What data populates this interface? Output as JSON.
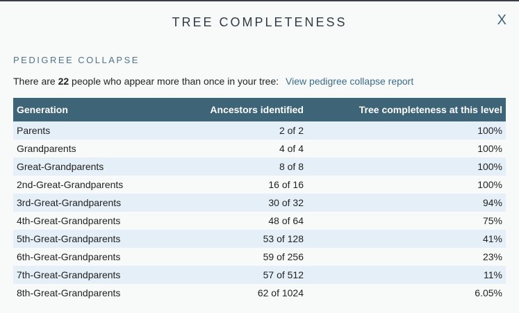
{
  "modal": {
    "title": "TREE COMPLETENESS",
    "close_label": "X"
  },
  "pedigree": {
    "heading": "PEDIGREE COLLAPSE",
    "summary_prefix": "There are ",
    "count": "22",
    "summary_suffix": " people who appear more than once in your tree:",
    "report_link": "View pedigree collapse report"
  },
  "table": {
    "headers": [
      "Generation",
      "Ancestors identified",
      "Tree completeness at this level"
    ],
    "rows": [
      [
        "Parents",
        "2 of 2",
        "100%"
      ],
      [
        "Grandparents",
        "4 of 4",
        "100%"
      ],
      [
        "Great-Grandparents",
        "8 of 8",
        "100%"
      ],
      [
        "2nd-Great-Grandparents",
        "16 of 16",
        "100%"
      ],
      [
        "3rd-Great-Grandparents",
        "30 of 32",
        "94%"
      ],
      [
        "4th-Great-Grandparents",
        "48 of 64",
        "75%"
      ],
      [
        "5th-Great-Grandparents",
        "53 of 128",
        "41%"
      ],
      [
        "6th-Great-Grandparents",
        "59 of 256",
        "23%"
      ],
      [
        "7th-Great-Grandparents",
        "57 of 512",
        "11%"
      ],
      [
        "8th-Great-Grandparents",
        "62 of 1024",
        "6.05%"
      ]
    ]
  },
  "colors": {
    "header_bg": "#3e6477",
    "row_alt_bg": "#e4eff7",
    "link": "#3b6c88",
    "accent": "#4f7488"
  }
}
